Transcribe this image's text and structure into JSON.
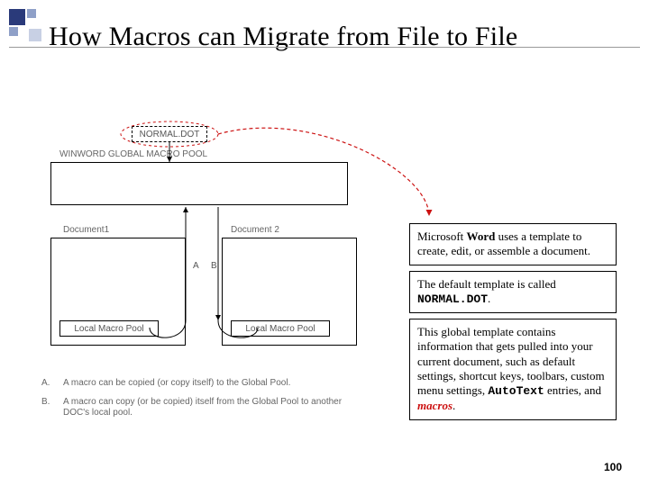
{
  "title": "How Macros can Migrate from File to File",
  "diagram": {
    "normal_dot": "NORMAL.DOT",
    "global_pool": "WINWORD GLOBAL MACRO POOL",
    "doc1": "Document1",
    "doc2": "Document 2",
    "local_pool_1": "Local Macro Pool",
    "local_pool_2": "Local Macro Pool",
    "arrow_a": "A",
    "arrow_b": "B"
  },
  "notes": {
    "a": {
      "tag": "A.",
      "text": "A macro can be copied (or copy itself) to the Global Pool."
    },
    "b": {
      "tag": "B.",
      "text": "A macro can copy (or be copied) itself from the Global Pool to another DOC's local pool."
    }
  },
  "callouts": {
    "c1_pre": "Microsoft ",
    "c1_word": "Word",
    "c1_post": " uses a template to create, edit, or assemble a document.",
    "c2_pre": "The default template is called ",
    "c2_normal": "NORMAL.DOT",
    "c2_post": ".",
    "c3_pre": "This global template contains information that gets pulled into your current document, such as default settings, shortcut keys, toolbars, custom menu settings, ",
    "c3_autotext": "AutoText",
    "c3_mid": " entries, and ",
    "c3_macros": "macros",
    "c3_post": "."
  },
  "page_number": "100"
}
